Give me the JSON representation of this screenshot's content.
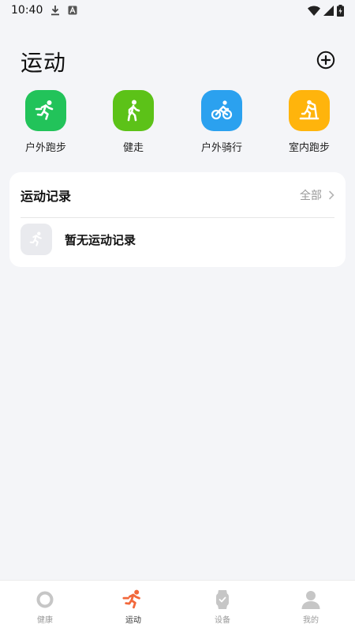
{
  "status_bar": {
    "time": "10:40"
  },
  "header": {
    "title": "运动"
  },
  "quick_start": [
    {
      "label": "户外跑步",
      "color": "#22c35a",
      "icon": "running-icon"
    },
    {
      "label": "健走",
      "color": "#5cc218",
      "icon": "walking-icon"
    },
    {
      "label": "户外骑行",
      "color": "#2ba1ef",
      "icon": "cycling-icon"
    },
    {
      "label": "室内跑步",
      "color": "#ffb40c",
      "icon": "treadmill-icon"
    }
  ],
  "records": {
    "title": "运动记录",
    "all_label": "全部",
    "empty_text": "暂无运动记录"
  },
  "bottom_nav": {
    "items": [
      {
        "label": "健康",
        "icon": "health-ring-icon",
        "active": false
      },
      {
        "label": "运动",
        "icon": "running-icon",
        "active": true
      },
      {
        "label": "设备",
        "icon": "watch-icon",
        "active": false
      },
      {
        "label": "我的",
        "icon": "profile-icon",
        "active": false
      }
    ]
  },
  "colors": {
    "background": "#f4f5f8",
    "card": "#ffffff",
    "accent_active": "#f2683b",
    "nav_inactive": "#c6c6c6"
  }
}
